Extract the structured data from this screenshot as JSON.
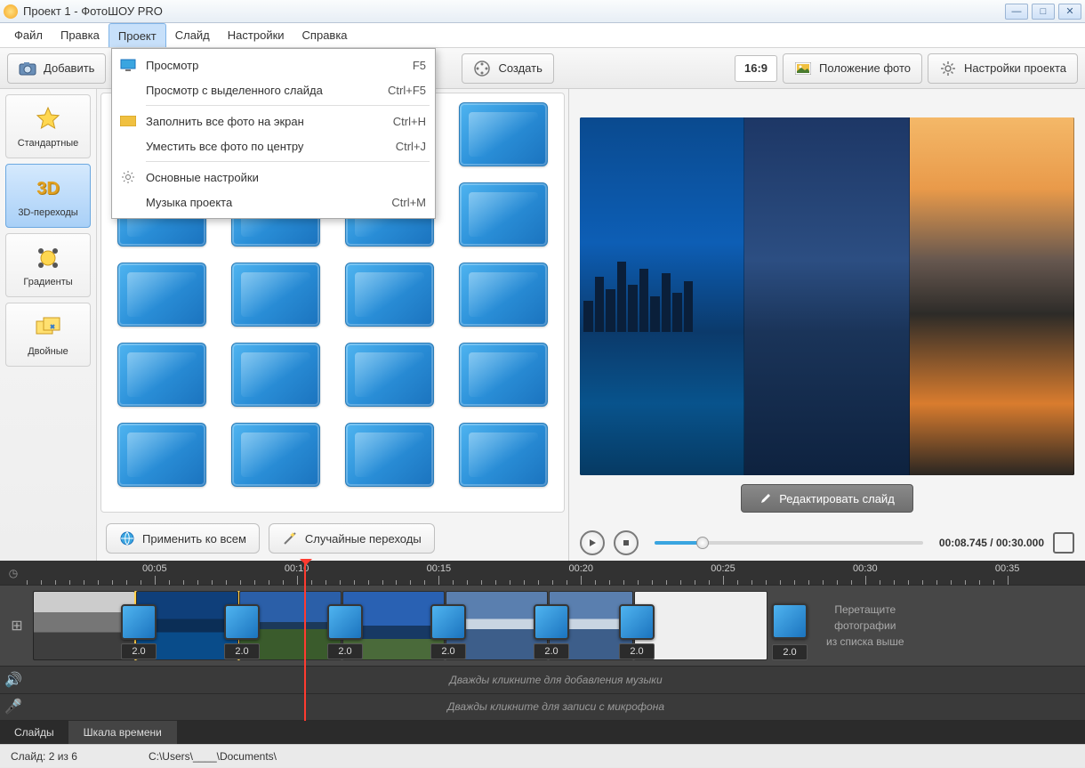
{
  "window": {
    "title": "Проект 1 - ФотоШОУ PRO"
  },
  "menu": {
    "items": [
      "Файл",
      "Правка",
      "Проект",
      "Слайд",
      "Настройки",
      "Справка"
    ],
    "active": "Проект"
  },
  "dropdown": {
    "items": [
      {
        "label": "Просмотр",
        "shortcut": "F5",
        "icon": "monitor"
      },
      {
        "label": "Просмотр с выделенного слайда",
        "shortcut": "Ctrl+F5",
        "icon": ""
      },
      {
        "sep": true
      },
      {
        "label": "Заполнить все фото на экран",
        "shortcut": "Ctrl+H",
        "icon": "fill"
      },
      {
        "label": "Уместить все фото по центру",
        "shortcut": "Ctrl+J",
        "icon": ""
      },
      {
        "sep": true
      },
      {
        "label": "Основные настройки",
        "shortcut": "",
        "icon": "gear"
      },
      {
        "label": "Музыка проекта",
        "shortcut": "Ctrl+M",
        "icon": ""
      }
    ]
  },
  "toolbar": {
    "add": "Добавить",
    "create": "Создать",
    "aspect": "16:9",
    "photo_pos": "Положение фото",
    "project_settings": "Настройки проекта"
  },
  "categories": [
    {
      "label": "Стандартные",
      "icon": "star"
    },
    {
      "label": "3D-переходы",
      "icon": "3d",
      "active": true
    },
    {
      "label": "Градиенты",
      "icon": "grad"
    },
    {
      "label": "Двойные",
      "icon": "double"
    }
  ],
  "bottom_buttons": {
    "apply_all": "Применить ко всем",
    "random": "Случайные переходы"
  },
  "preview": {
    "edit_slide": "Редактировать слайд",
    "time_current": "00:08.745",
    "time_total": "00:30.000"
  },
  "timeline": {
    "markers": [
      "00:05",
      "00:10",
      "00:15",
      "00:20",
      "00:25",
      "00:30",
      "00:35"
    ],
    "playhead_pos_pct": 26.2,
    "transition_duration": "2.0",
    "drag_hint_l1": "Перетащите",
    "drag_hint_l2": "фотографии",
    "drag_hint_l3": "из списка выше",
    "music_hint": "Дважды кликните для добавления музыки",
    "mic_hint": "Дважды кликните для записи с микрофона"
  },
  "tabs": {
    "slides": "Слайды",
    "scale": "Шкала времени"
  },
  "status": {
    "slide": "Слайд: 2 из 6",
    "path": "C:\\Users\\____\\Documents\\"
  }
}
